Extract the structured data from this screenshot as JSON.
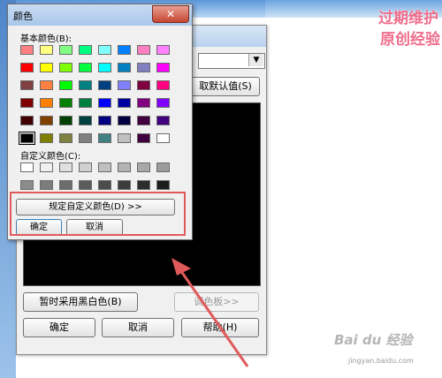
{
  "color_dialog": {
    "title": "颜色",
    "close": "✕",
    "basic_label": "基本颜色(B):",
    "basic_colors": [
      [
        "#ff8080",
        "#ffff80",
        "#80ff80",
        "#00ff80",
        "#80ffff",
        "#0080ff",
        "#ff80c0",
        "#ff80ff"
      ],
      [
        "#ff0000",
        "#ffff00",
        "#80ff00",
        "#00ff40",
        "#00ffff",
        "#0080c0",
        "#8080c0",
        "#ff00ff"
      ],
      [
        "#804040",
        "#ff8040",
        "#00ff00",
        "#008080",
        "#004080",
        "#8080ff",
        "#800040",
        "#ff0080"
      ],
      [
        "#800000",
        "#ff8000",
        "#008000",
        "#008040",
        "#0000ff",
        "#0000a0",
        "#800080",
        "#8000ff"
      ],
      [
        "#400000",
        "#804000",
        "#004000",
        "#004040",
        "#000080",
        "#000040",
        "#400040",
        "#400080"
      ],
      [
        "#000000",
        "#808000",
        "#808040",
        "#808080",
        "#408080",
        "#c0c0c0",
        "#400040",
        "#ffffff"
      ]
    ],
    "custom_label": "自定义颜色(C):",
    "custom_colors": [
      [
        "#ffffff",
        "#f0f0f0",
        "#e0e0e0",
        "#d0d0d0",
        "#c0c0c0",
        "#b4b4b4",
        "#a8a8a8",
        "#9c9c9c"
      ],
      [
        "#8c8c8c",
        "#7c7c7c",
        "#6c6c6c",
        "#5c5c5c",
        "#4c4c4c",
        "#3c3c3c",
        "#2c2c2c",
        "#1c1c1c"
      ]
    ],
    "define_custom": "规定自定义颜色(D) >>",
    "ok": "确定",
    "cancel": "取消"
  },
  "under_dialog": {
    "default_button": "取默认值(S)",
    "bw_button": "暂时采用黑白色(B)",
    "adjust_button": "调色板>>",
    "ok": "确定",
    "cancel": "取消",
    "help": "帮助(H)"
  },
  "watermark": {
    "line1": "过期维护",
    "line2": "原创经验"
  },
  "baidu": {
    "logo": "Bai du 经验",
    "url": "jingyan.baidu.com"
  },
  "colors": {
    "annotation_red": "#e05a5a",
    "title_bar": "#b8d2ee",
    "close_red": "#c64531"
  }
}
